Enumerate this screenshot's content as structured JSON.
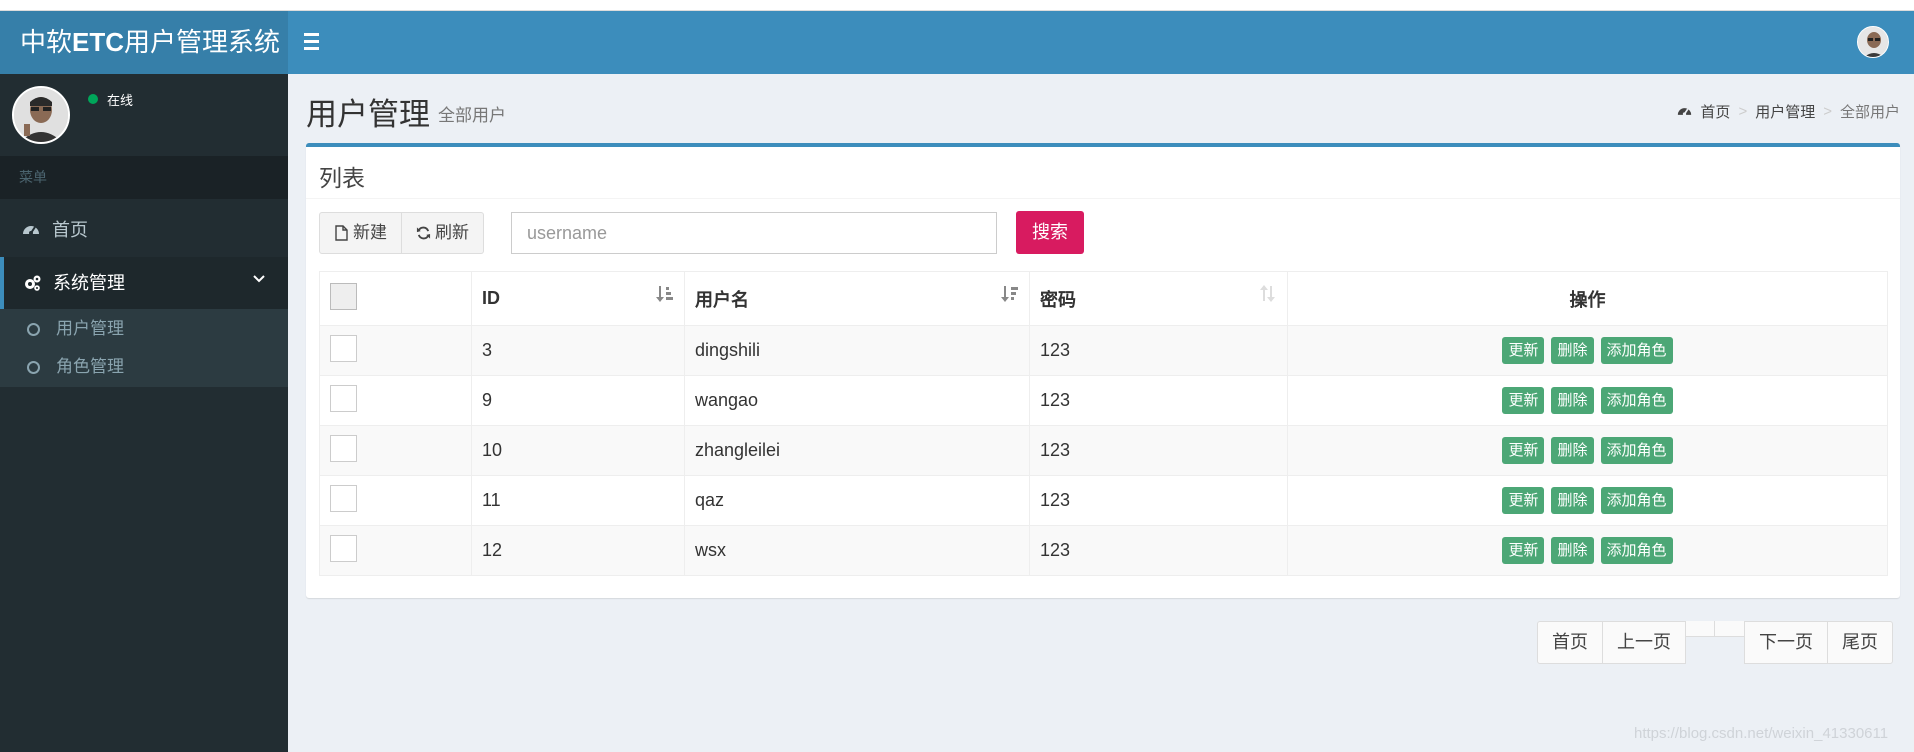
{
  "app": {
    "logo_prefix": "中软",
    "logo_bold": "ETC",
    "logo_suffix": "用户管理系统"
  },
  "user": {
    "status": "在线"
  },
  "sidebar": {
    "menu_header": "菜单",
    "items": [
      {
        "label": "首页",
        "icon": "dashboard-icon"
      },
      {
        "label": "系统管理",
        "icon": "cogs-icon",
        "expanded": true
      }
    ],
    "sub_items": [
      {
        "label": "用户管理"
      },
      {
        "label": "角色管理"
      }
    ]
  },
  "page": {
    "title": "用户管理",
    "subtitle": "全部用户"
  },
  "breadcrumb": {
    "home": "首页",
    "level1": "用户管理",
    "current": "全部用户",
    "separator": ">"
  },
  "box": {
    "title": "列表"
  },
  "toolbar": {
    "new_label": "新建",
    "refresh_label": "刷新",
    "search_placeholder": "username",
    "search_label": "搜索"
  },
  "table": {
    "headers": {
      "id": "ID",
      "username": "用户名",
      "password": "密码",
      "actions": "操作"
    },
    "rows": [
      {
        "id": "3",
        "username": "dingshili",
        "password": "123"
      },
      {
        "id": "9",
        "username": "wangao",
        "password": "123"
      },
      {
        "id": "10",
        "username": "zhangleilei",
        "password": "123"
      },
      {
        "id": "11",
        "username": "qaz",
        "password": "123"
      },
      {
        "id": "12",
        "username": "wsx",
        "password": "123"
      }
    ],
    "action_labels": {
      "update": "更新",
      "delete": "删除",
      "add_role": "添加角色"
    }
  },
  "pagination": {
    "first": "首页",
    "prev": "上一页",
    "next": "下一页",
    "last": "尾页"
  },
  "watermark": "https://blog.csdn.net/weixin_41330611",
  "colors": {
    "header": "#3c8dbc",
    "logo_bg": "#367fa9",
    "sidebar": "#222d32",
    "search_button": "#d81b60",
    "action_button": "#4ca776",
    "online": "#00a65a"
  }
}
